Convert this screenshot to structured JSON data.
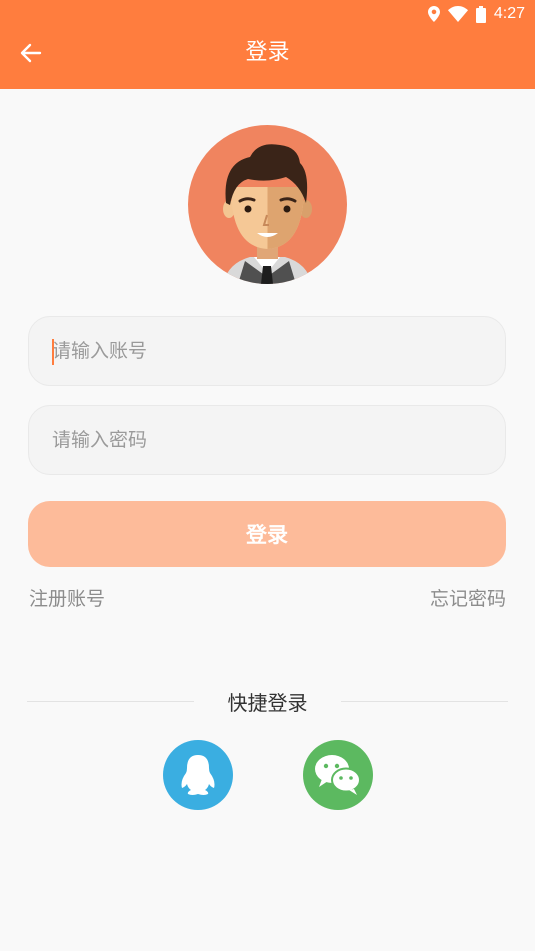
{
  "status_bar": {
    "time": "4:27",
    "icons": [
      "location-icon",
      "wifi-icon",
      "battery-icon"
    ]
  },
  "toolbar": {
    "title": "登录",
    "back_icon": "arrow-left-icon"
  },
  "avatar": {
    "icon": "user-avatar-illustration"
  },
  "form": {
    "account_placeholder": "请输入账号",
    "password_placeholder": "请输入密码",
    "login_label": "登录"
  },
  "links": {
    "register": "注册账号",
    "forgot": "忘记密码"
  },
  "quick_login": {
    "title": "快捷登录",
    "options": [
      {
        "name": "qq",
        "icon": "qq-icon",
        "color": "#3aaee1"
      },
      {
        "name": "wechat",
        "icon": "wechat-icon",
        "color": "#5cb960"
      }
    ]
  },
  "colors": {
    "primary": "#ff7d3e",
    "button_disabled": "#fdbb9a",
    "background": "#f9f9f9"
  }
}
